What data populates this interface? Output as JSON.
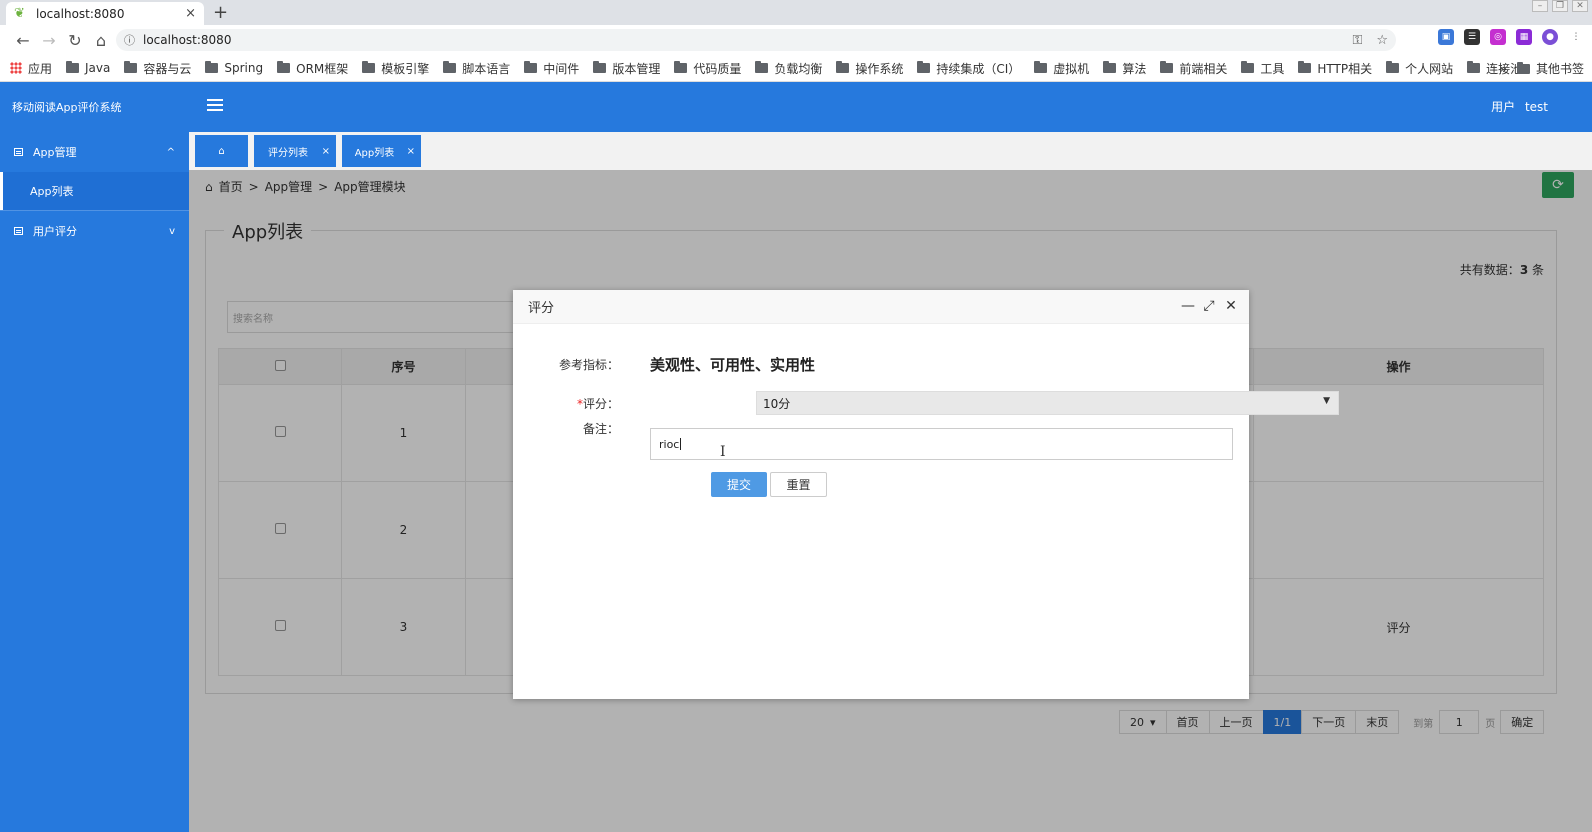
{
  "browser": {
    "tab_title": "localhost:8080",
    "tab_close": "×",
    "new_tab": "+",
    "url": "localhost:8080",
    "bookmarks": [
      "应用",
      "Java",
      "容器与云",
      "Spring",
      "ORM框架",
      "模板引擎",
      "脚本语言",
      "中间件",
      "版本管理",
      "代码质量",
      "负载均衡",
      "操作系统",
      "持续集成（CI）",
      "虚拟机",
      "算法",
      "前端相关",
      "工具",
      "HTTP相关",
      "个人网站",
      "连接池"
    ],
    "bookmarks_more": "»",
    "other_bookmarks": "其他书签"
  },
  "app": {
    "brand": "移动阅读App评价系统",
    "menu": [
      {
        "label": "App管理",
        "chevron": "^"
      },
      {
        "label": "用户评分",
        "chevron": "v"
      }
    ],
    "submenu_active": "App列表",
    "user_label": "用户",
    "user_name": "test",
    "tabs": [
      {
        "label": "⌂",
        "close": ""
      },
      {
        "label": "评分列表",
        "close": "×"
      },
      {
        "label": "App列表",
        "close": "×"
      }
    ],
    "breadcrumb": {
      "home": "首页",
      "sep1": ">",
      "level1": "App管理",
      "sep2": ">",
      "level2": "App管理模块"
    },
    "refresh": "⟳",
    "section_title": "App列表",
    "total_prefix": "共有数据：",
    "total_count": "3",
    "total_suffix": " 条",
    "search_placeholder": "搜索名称",
    "table": {
      "headers": {
        "index": "序号",
        "actions": "操作"
      },
      "rows": [
        {
          "index": "1",
          "action": ""
        },
        {
          "index": "2",
          "action": ""
        },
        {
          "index": "3",
          "action": "评分"
        }
      ]
    },
    "pager": {
      "page_size": "20",
      "page_size_arrow": "▾",
      "first": "首页",
      "prev": "上一页",
      "current": "1/1",
      "next": "下一页",
      "last": "末页",
      "goto_label": "到第",
      "goto_value": "1",
      "page_unit": "页",
      "confirm": "确定"
    }
  },
  "modal": {
    "title": "评分",
    "minimize": "—",
    "maximize": "⤢",
    "close": "✕",
    "ref_label": "参考指标：",
    "ref_value": "美观性、可用性、实用性",
    "score_required": "*",
    "score_label": "评分：",
    "score_value": "10分",
    "score_arrow": "▼",
    "remark_label": "备注：",
    "remark_value": "rioc",
    "submit": "提交",
    "reset": "重置"
  }
}
